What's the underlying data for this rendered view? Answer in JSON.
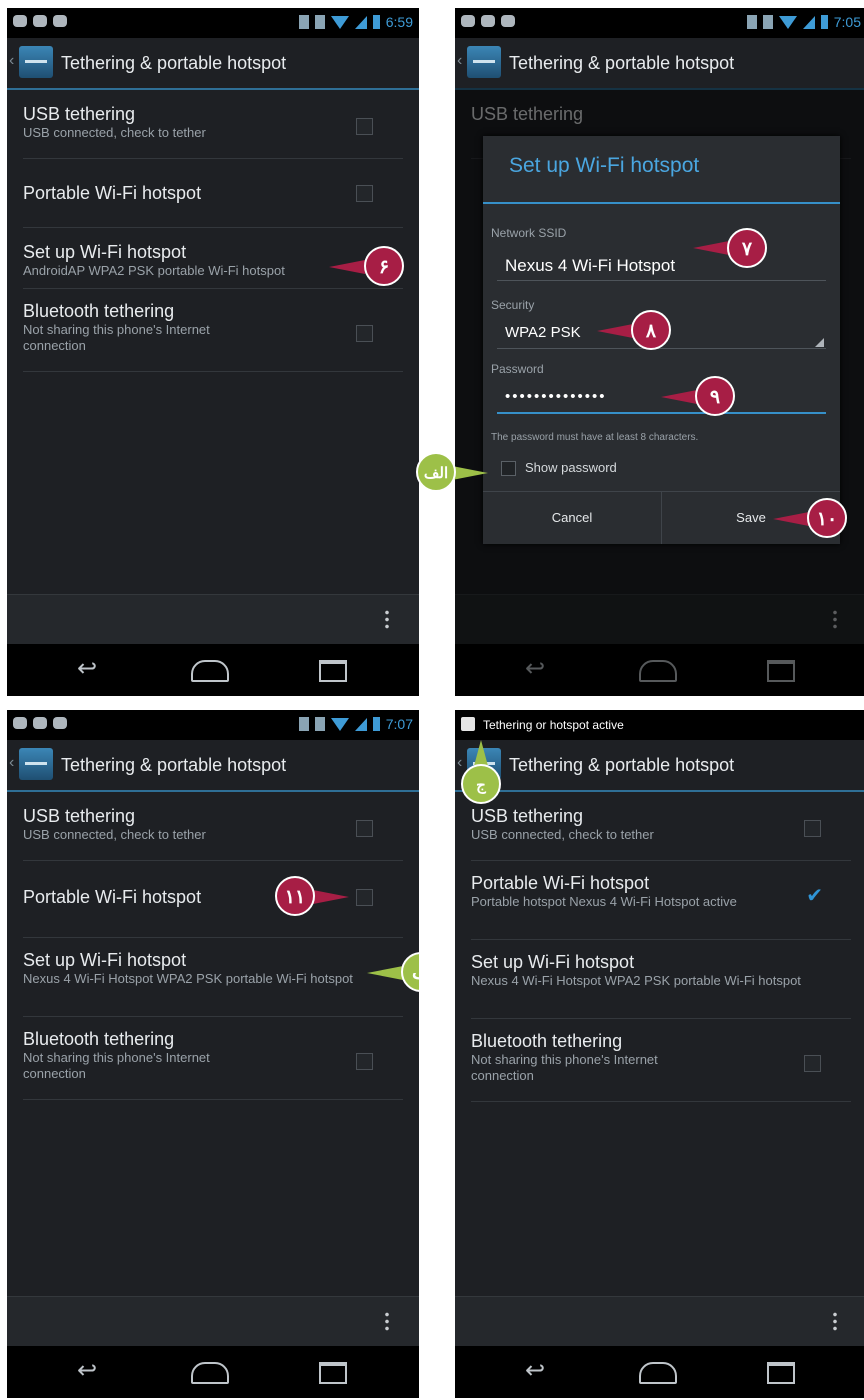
{
  "app_title": "Tethering & portable hotspot",
  "items": {
    "usb_title": "USB tethering",
    "usb_sub": "USB connected, check to tether",
    "hotspot_title": "Portable Wi-Fi hotspot",
    "hotspot_sub_active": "Portable hotspot Nexus 4 Wi-Fi Hotspot active",
    "setup_title": "Set up Wi-Fi hotspot",
    "setup_sub_default": "AndroidAP WPA2 PSK portable Wi-Fi hotspot",
    "setup_sub_custom": "Nexus 4 Wi-Fi Hotspot WPA2 PSK portable Wi-Fi hotspot",
    "bt_title": "Bluetooth tethering",
    "bt_sub": "Not sharing this phone's Internet connection"
  },
  "times": [
    "6:59",
    "7:05",
    "7:07"
  ],
  "notification": "Tethering or hotspot active",
  "dialog": {
    "title": "Set up Wi-Fi hotspot",
    "ssid_label": "Network SSID",
    "ssid_value": "Nexus 4 Wi-Fi Hotspot",
    "security_label": "Security",
    "security_value": "WPA2 PSK",
    "password_label": "Password",
    "password_value": "••••••••••••••",
    "hint": "The password must have at least 8 characters.",
    "show_password": "Show password",
    "cancel": "Cancel",
    "save": "Save"
  },
  "callouts": {
    "c6": "۶",
    "c7": "۷",
    "c8": "۸",
    "c9": "۹",
    "c10": "۱۰",
    "c11": "۱۱",
    "alef": "الف",
    "be": "ب",
    "jim": "ج"
  },
  "colors": {
    "accent": "#3690c9",
    "callout_red": "#a71e45",
    "callout_green": "#9dc048"
  },
  "icons": [
    "back-nav-icon",
    "home-nav-icon",
    "recent-apps-icon",
    "overflow-menu-icon",
    "wifi-icon",
    "battery-icon",
    "hotspot-notification-icon"
  ]
}
